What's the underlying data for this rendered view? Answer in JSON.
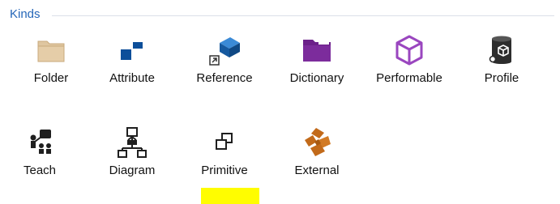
{
  "group": {
    "title": "Kinds"
  },
  "kinds": [
    {
      "label": "Folder",
      "icon": "folder-icon"
    },
    {
      "label": "Attribute",
      "icon": "attribute-icon"
    },
    {
      "label": "Reference",
      "icon": "reference-icon"
    },
    {
      "label": "Dictionary",
      "icon": "dictionary-folder-icon"
    },
    {
      "label": "Performable",
      "icon": "cube-outline-icon"
    },
    {
      "label": "Profile",
      "icon": "profile-cylinder-icon"
    },
    {
      "label": "Teach",
      "icon": "teach-icon"
    },
    {
      "label": "Diagram",
      "icon": "diagram-hierarchy-icon"
    },
    {
      "label": "Primitive",
      "icon": "primitive-squares-icon"
    },
    {
      "label": "External",
      "icon": "external-puzzle-icon"
    }
  ],
  "colors": {
    "title": "#2566b8",
    "rule": "#dbe0e8",
    "highlight": "#fffd00",
    "folder": "#dfc6a0",
    "attribute": "#0d4f9a",
    "reference": "#1b68b3",
    "dictionary": "#6c218a",
    "performable": "#9a46bf",
    "profile": "#2d2d2d",
    "external": "#c26a1a"
  }
}
